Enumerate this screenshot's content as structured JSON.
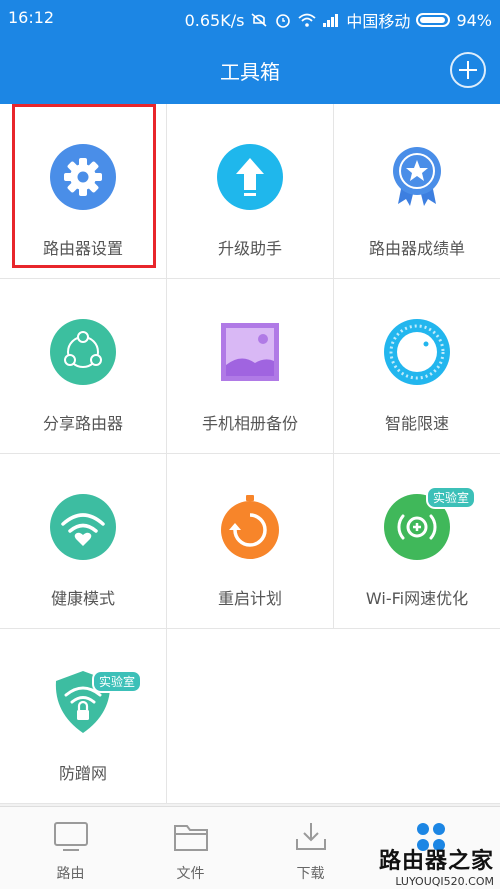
{
  "status_bar": {
    "time": "16:12",
    "speed": "0.65K/s",
    "carrier": "中国移动",
    "battery": "94%",
    "icons": [
      "mute-icon",
      "alarm-icon",
      "wifi-icon",
      "signal-icon",
      "battery-icon"
    ]
  },
  "header": {
    "title": "工具箱",
    "add_icon": "plus-icon"
  },
  "tools": [
    {
      "label": "路由器设置",
      "icon": "gear-icon",
      "highlighted": true
    },
    {
      "label": "升级助手",
      "icon": "upgrade-arrow-icon"
    },
    {
      "label": "路由器成绩单",
      "icon": "medal-icon"
    },
    {
      "label": "分享路由器",
      "icon": "share-icon"
    },
    {
      "label": "手机相册备份",
      "icon": "photo-icon"
    },
    {
      "label": "智能限速",
      "icon": "speed-dial-icon"
    },
    {
      "label": "健康模式",
      "icon": "wifi-heart-icon"
    },
    {
      "label": "重启计划",
      "icon": "restart-timer-icon"
    },
    {
      "label": "Wi-Fi网速优化",
      "icon": "wifi-boost-icon",
      "badge": "实验室"
    },
    {
      "label": "防蹭网",
      "icon": "shield-wifi-icon",
      "badge": "实验室"
    }
  ],
  "bottom_nav": [
    {
      "label": "路由",
      "icon": "monitor-icon"
    },
    {
      "label": "文件",
      "icon": "folder-icon"
    },
    {
      "label": "下载",
      "icon": "download-icon"
    },
    {
      "label": "",
      "icon": "grid-apps-icon",
      "active": true
    }
  ],
  "watermark": {
    "line1": "路由器之家",
    "line2": "LUYOUQI520.COM"
  },
  "colors": {
    "primary": "#1c86e4",
    "highlight_border": "#e8262b",
    "badge": "#3cc0b8"
  }
}
